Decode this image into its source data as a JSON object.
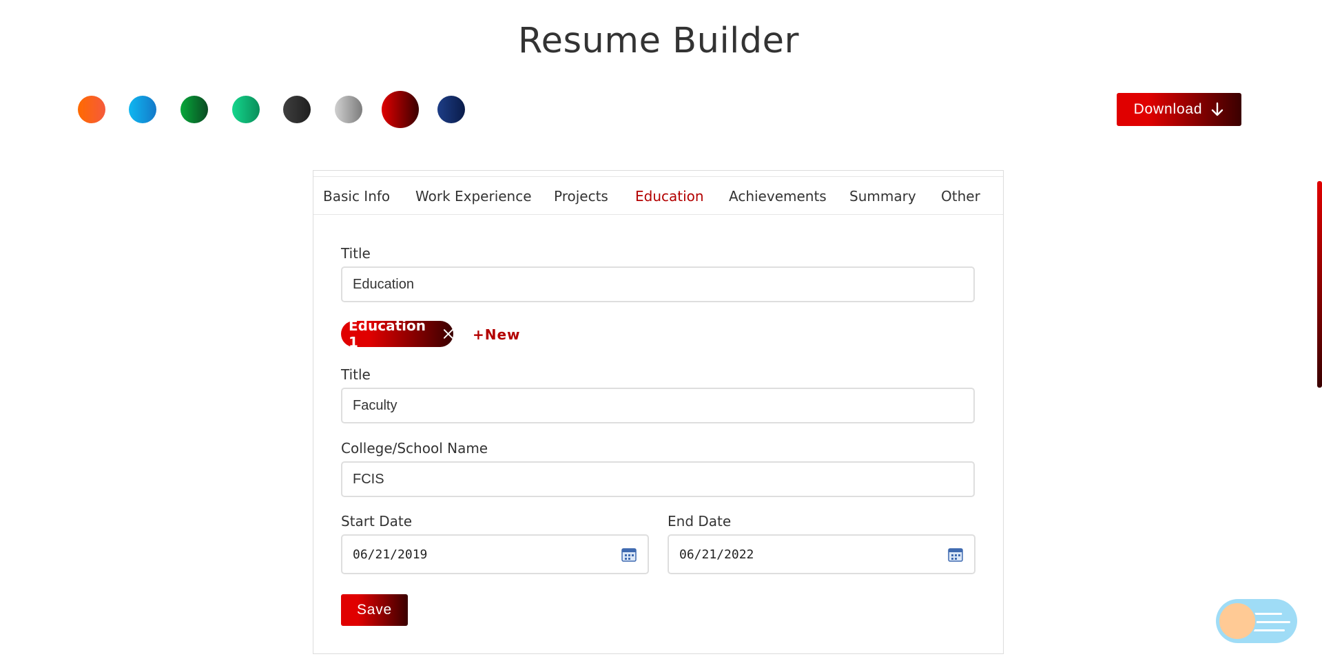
{
  "app": {
    "title": "Resume Builder"
  },
  "theme": {
    "accent": "#e00000",
    "accent_dark": "#3a0000",
    "active_tab_color": "#b30000",
    "colors": [
      {
        "name": "orange",
        "from": "#ff6a00",
        "to": "#f55a3c"
      },
      {
        "name": "blue",
        "from": "#0fb7f0",
        "to": "#1479c9"
      },
      {
        "name": "green",
        "from": "#07a83a",
        "to": "#0a4a22"
      },
      {
        "name": "mint",
        "from": "#14d68c",
        "to": "#0a8e5a"
      },
      {
        "name": "black",
        "from": "#3f3f3f",
        "to": "#1f1f1f"
      },
      {
        "name": "gray",
        "from": "#cfcfcf",
        "to": "#7d7d7d"
      },
      {
        "name": "red",
        "from": "#e00000",
        "to": "#3a0000",
        "selected": true
      },
      {
        "name": "navy",
        "from": "#1d3d86",
        "to": "#0a1c4a"
      }
    ]
  },
  "toolbar": {
    "download_label": "Download",
    "download_icon": "arrow-down-icon"
  },
  "tabs": [
    {
      "label": "Basic Info",
      "active": false
    },
    {
      "label": "Work Experience",
      "active": false
    },
    {
      "label": "Projects",
      "active": false
    },
    {
      "label": "Education",
      "active": true
    },
    {
      "label": "Achievements",
      "active": false
    },
    {
      "label": "Summary",
      "active": false
    },
    {
      "label": "Other",
      "active": false
    }
  ],
  "section": {
    "title_label": "Title",
    "title_value": "Education"
  },
  "entries": {
    "chips": [
      {
        "label": "Education 1",
        "icon": "close-icon"
      }
    ],
    "new_label": "+New"
  },
  "form": {
    "title_label": "Title",
    "title_value": "Faculty",
    "college_label": "College/School Name",
    "college_value": "FCIS",
    "start_label": "Start Date",
    "start_value": "06/21/2019",
    "end_label": "End Date",
    "end_value": "06/21/2022",
    "calendar_icon": "calendar-icon"
  },
  "actions": {
    "save_label": "Save"
  },
  "widgets": {
    "fab_icon": "menu-toggle-icon"
  }
}
